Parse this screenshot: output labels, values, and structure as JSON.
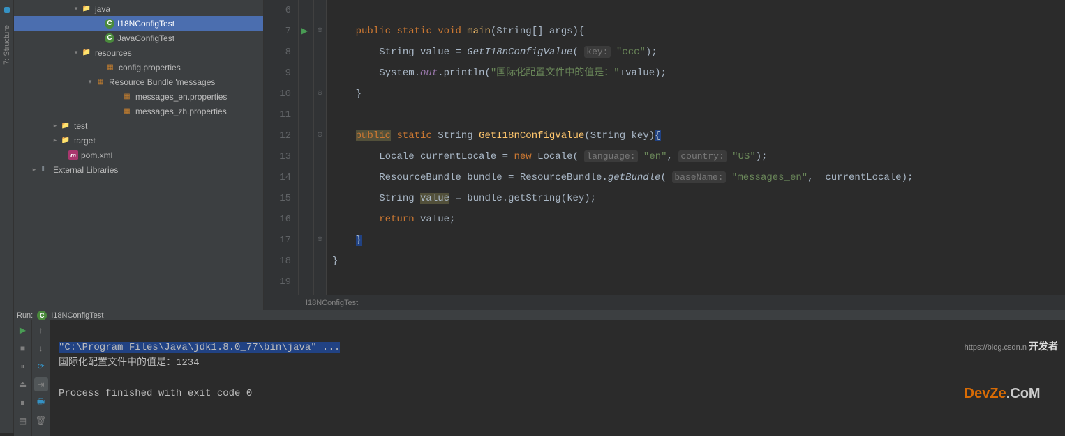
{
  "left_tabs": [
    "7: Structure"
  ],
  "project": {
    "items": [
      {
        "indent": 82,
        "arrow": "▾",
        "icon": "folder-src",
        "iconChar": "📁",
        "label": "java"
      },
      {
        "indent": 116,
        "arrow": "",
        "icon": "class",
        "iconChar": "C",
        "label": "I18NConfigTest",
        "highlighted": true
      },
      {
        "indent": 116,
        "arrow": "",
        "icon": "class",
        "iconChar": "C",
        "label": "JavaConfigTest"
      },
      {
        "indent": 82,
        "arrow": "▾",
        "icon": "folder",
        "iconChar": "📁",
        "label": "resources"
      },
      {
        "indent": 116,
        "arrow": "",
        "icon": "props",
        "iconChar": "▦",
        "label": "config.properties"
      },
      {
        "indent": 102,
        "arrow": "▾",
        "icon": "bundle",
        "iconChar": "▦",
        "label": "Resource Bundle 'messages'"
      },
      {
        "indent": 140,
        "arrow": "",
        "icon": "props",
        "iconChar": "▦",
        "label": "messages_en.properties"
      },
      {
        "indent": 140,
        "arrow": "",
        "icon": "props",
        "iconChar": "▦",
        "label": "messages_zh.properties"
      },
      {
        "indent": 52,
        "arrow": "▸",
        "icon": "folder",
        "iconChar": "📁",
        "label": "test"
      },
      {
        "indent": 52,
        "arrow": "▸",
        "icon": "folder-orange",
        "iconChar": "📁",
        "label": "target"
      },
      {
        "indent": 64,
        "arrow": "",
        "icon": "maven",
        "iconChar": "m",
        "label": "pom.xml"
      },
      {
        "indent": 22,
        "arrow": "▸",
        "icon": "lib",
        "iconChar": "⊪",
        "label": "External Libraries"
      }
    ]
  },
  "editor": {
    "lines": [
      {
        "n": 6,
        "html": ""
      },
      {
        "n": 7,
        "run": true,
        "fold": "⊖",
        "html": "    <span class='kw'>public</span> <span class='kw'>static</span> <span class='kw'>void</span> <span class='method'>main</span>(String[] args){"
      },
      {
        "n": 8,
        "html": "        String value = <span style='font-style:italic'>GetI18nConfigValue</span>( <span class='param-hint'>key:</span> <span class='str'>\"ccc\"</span>);"
      },
      {
        "n": 9,
        "html": "        System.<span class='st'>out</span>.println(<span class='str'>\"国际化配置文件中的值是：\"</span>+value);"
      },
      {
        "n": 10,
        "fold": "⊖",
        "html": "    }"
      },
      {
        "n": 11,
        "html": ""
      },
      {
        "n": 12,
        "fold": "⊖",
        "html": "    <span class='kw hl-warn'>public</span> <span class='kw'>static</span> String <span class='method'>GetI18nConfigValue</span>(String key)<span class='hl-caret'>{</span>"
      },
      {
        "n": 13,
        "html": "        Locale currentLocale = <span class='kw'>new</span> Locale( <span class='param-hint'>language:</span> <span class='str'>\"en\"</span>, <span class='param-hint'>country:</span> <span class='str'>\"US\"</span>);"
      },
      {
        "n": 14,
        "html": "        ResourceBundle bundle = ResourceBundle.<span style='font-style:italic'>getBundle</span>( <span class='param-hint'>baseName:</span> <span class='str'>\"messages_en\"</span>,  currentLocale);"
      },
      {
        "n": 15,
        "html": "        String <span class='hl-warn'>value</span> = bundle.getString(key);"
      },
      {
        "n": 16,
        "html": "        <span class='kw'>return</span> value;"
      },
      {
        "n": 17,
        "fold": "⊖",
        "html": "    <span class='hl-caret'>}</span>"
      },
      {
        "n": 18,
        "html": "}"
      },
      {
        "n": 19,
        "html": ""
      }
    ],
    "breadcrumb": "I18NConfigTest"
  },
  "run": {
    "label": "Run:",
    "config": "I18NConfigTest",
    "output": {
      "cmd": "\"C:\\Program Files\\Java\\jdk1.8.0_77\\bin\\java\" ...",
      "line1": "国际化配置文件中的值是：1234",
      "blank": "",
      "line2": "Process finished with exit code 0"
    }
  },
  "watermark": {
    "url": "https://blog.csdn.n",
    "top": "开发者",
    "brand_a": "Dev",
    "brand_b": "Ze",
    "brand_c": ".CoM"
  }
}
